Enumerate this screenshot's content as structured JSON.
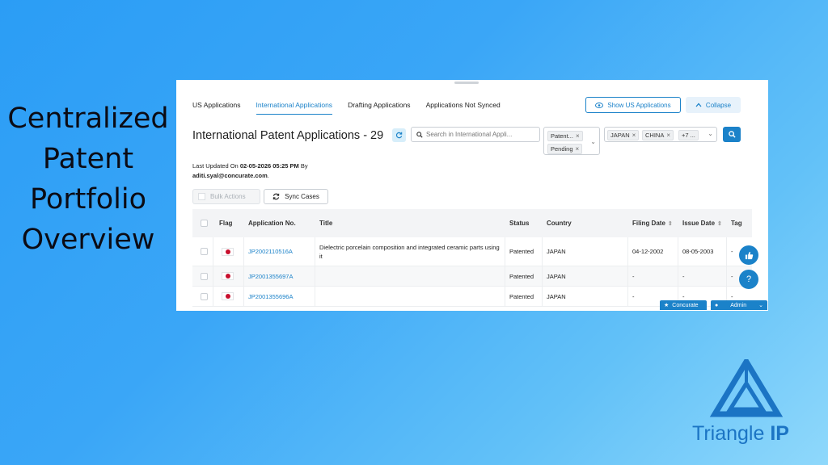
{
  "headline": [
    "Centralized",
    "Patent",
    "Portfolio",
    "Overview"
  ],
  "tabs": [
    {
      "label": "US Applications",
      "active": false
    },
    {
      "label": "International Applications",
      "active": true
    },
    {
      "label": "Drafting Applications",
      "active": false
    },
    {
      "label": "Applications Not Synced",
      "active": false
    }
  ],
  "buttons": {
    "show_us": "Show US Applications",
    "collapse": "Collapse",
    "bulk_actions": "Bulk Actions",
    "sync_cases": "Sync Cases"
  },
  "page": {
    "title": "International Patent Applications - 29",
    "updated_prefix": "Last Updated On",
    "updated_time": "02-05-2026 05:25 PM",
    "updated_by": "By",
    "user_email": "aditi.syal@concurate.com",
    "period": "."
  },
  "search": {
    "placeholder": "Search in International Appli..."
  },
  "filters": {
    "status_chips": [
      "Patent...",
      "Pending"
    ],
    "country_chips": [
      "JAPAN",
      "CHINA",
      "+7 ..."
    ]
  },
  "table": {
    "headers": {
      "flag": "Flag",
      "app_no": "Application No.",
      "title": "Title",
      "status": "Status",
      "country": "Country",
      "filing": "Filing Date",
      "issue": "Issue Date",
      "tags": "Tag"
    },
    "rows": [
      {
        "app_no": "JP2002110516A",
        "title": "Dielectric porcelain composition and integrated ceramic parts using it",
        "status": "Patented",
        "country": "JAPAN",
        "filing": "04-12-2002",
        "issue": "08-05-2003",
        "tags": "-"
      },
      {
        "app_no": "JP2001355697A",
        "title": "",
        "status": "Patented",
        "country": "JAPAN",
        "filing": "-",
        "issue": "-",
        "tags": "-"
      },
      {
        "app_no": "JP2001355696A",
        "title": "",
        "status": "Patented",
        "country": "JAPAN",
        "filing": "-",
        "issue": "-",
        "tags": "-"
      }
    ]
  },
  "footer": {
    "concurate": "Concurate",
    "admin": "Admin"
  },
  "brand": {
    "name_part1": "Triangle ",
    "name_part2": "IP"
  },
  "colors": {
    "accent": "#1b82c9",
    "brand": "#1b74c4",
    "background": "#3aa6f7"
  },
  "icons": {
    "like": "thumbs-up-icon",
    "help": "question-icon",
    "refresh": "refresh-icon",
    "search": "search-icon",
    "sync": "sync-icon",
    "eye": "eye-icon"
  }
}
